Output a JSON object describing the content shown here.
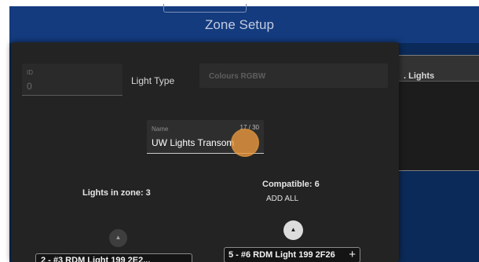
{
  "background": {
    "header_title": "Zone Setup",
    "panel_label": ". Lights"
  },
  "dialog": {
    "id_field": {
      "label": "ID",
      "value": "0"
    },
    "light_type": {
      "label": "Light Type",
      "value": "Colours RGBW"
    },
    "name_field": {
      "label": "Name",
      "value": "UW Lights Transom",
      "counter": "17 / 30"
    },
    "lights_in_zone": "Lights in zone: 3",
    "compatible": "Compatible: 6",
    "add_all_label": "ADD ALL",
    "up_icon": "▲",
    "zone_list_partial": "2 - #3 RDM Light 199 2E2...",
    "compatible_item": "5 - #6 RDM Light 199 2F26",
    "add_icon": "+"
  }
}
